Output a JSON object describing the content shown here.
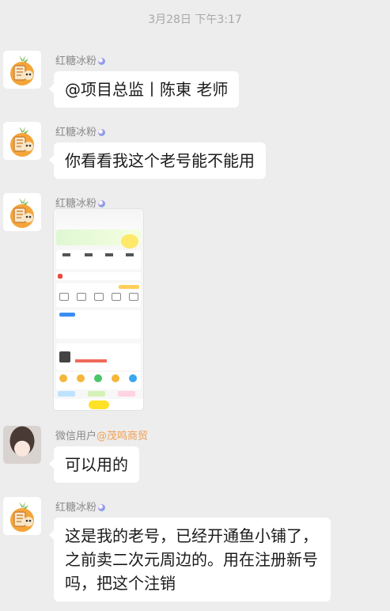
{
  "timestamp": "3月28日 下午3:17",
  "messages": [
    {
      "sender": "红糖冰粉",
      "text": "@项目总监丨陈東  老师"
    },
    {
      "sender": "红糖冰粉",
      "text": "你看看我这个老号能不能用"
    },
    {
      "sender": "红糖冰粉",
      "text": ""
    },
    {
      "sender": "微信用户",
      "sender_tag": "@茂鸣商贸",
      "text": "可以用的"
    },
    {
      "sender": "红糖冰粉",
      "text": "这是我的老号，已经开通鱼小铺了，之前卖二次元周边的。用在注册新号吗，把这个注销"
    }
  ],
  "colors": {
    "background": "#ededed",
    "bubble": "#ffffff",
    "sender_tag": "#f0a054",
    "timestamp": "#a8a8a8"
  }
}
